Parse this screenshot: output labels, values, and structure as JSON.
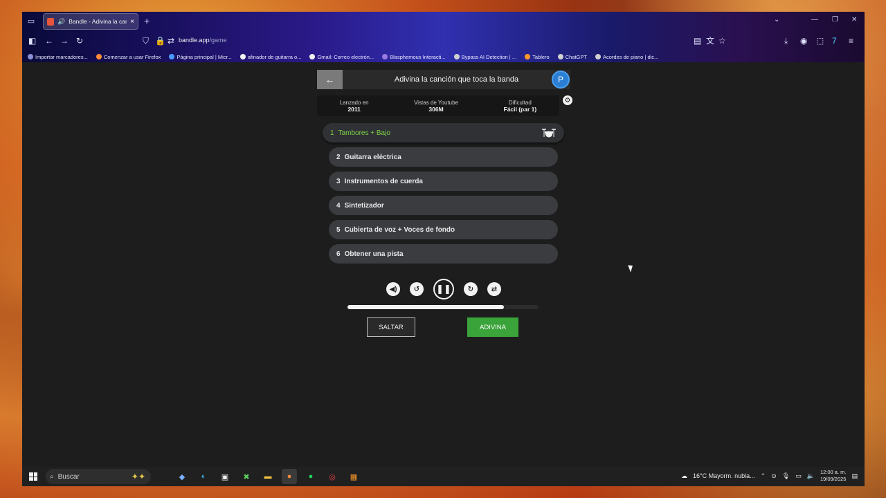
{
  "browser": {
    "tab_title": "Bandle - Adivina la canción",
    "url_host": "bandle.app",
    "url_path": "/game",
    "bookmarks": [
      "Importar marcadores...",
      "Comenzar a usar Firefox",
      "Página principal | Micr...",
      "afinador de guitarra o...",
      "Gmail: Correo electrón...",
      "Blasphemous Interacti...",
      "Bypass AI Detection | ...",
      "Tablero",
      "ChatGPT",
      "Acordes de piano | dic..."
    ]
  },
  "game": {
    "title": "Adivina la canción que toca la banda",
    "avatar_letter": "P",
    "info": [
      {
        "label": "Lanzado en",
        "value": "2011"
      },
      {
        "label": "Vistas de Youtube",
        "value": "306M"
      },
      {
        "label": "Dificultad",
        "value": "Fácil (par 1)"
      }
    ],
    "tracks": [
      {
        "num": "1",
        "label": "Tambores + Bajo"
      },
      {
        "num": "2",
        "label": "Guitarra eléctrica"
      },
      {
        "num": "3",
        "label": "Instrumentos de cuerda"
      },
      {
        "num": "4",
        "label": "Sintetizador"
      },
      {
        "num": "5",
        "label": "Cubierta de voz + Voces de fondo"
      },
      {
        "num": "6",
        "label": "Obtener una pista"
      }
    ],
    "progress_percent": 82,
    "skip_label": "SALTAR",
    "guess_label": "ADIVINA"
  },
  "taskbar": {
    "search_placeholder": "Buscar",
    "weather": "16°C  Mayorm. nubla...",
    "time": "12:00 a. m.",
    "date": "19/09/2025"
  },
  "colors": {
    "accent_green": "#3aa33a",
    "active_track_text": "#7fd34a",
    "avatar_blue": "#2a7fd4"
  }
}
